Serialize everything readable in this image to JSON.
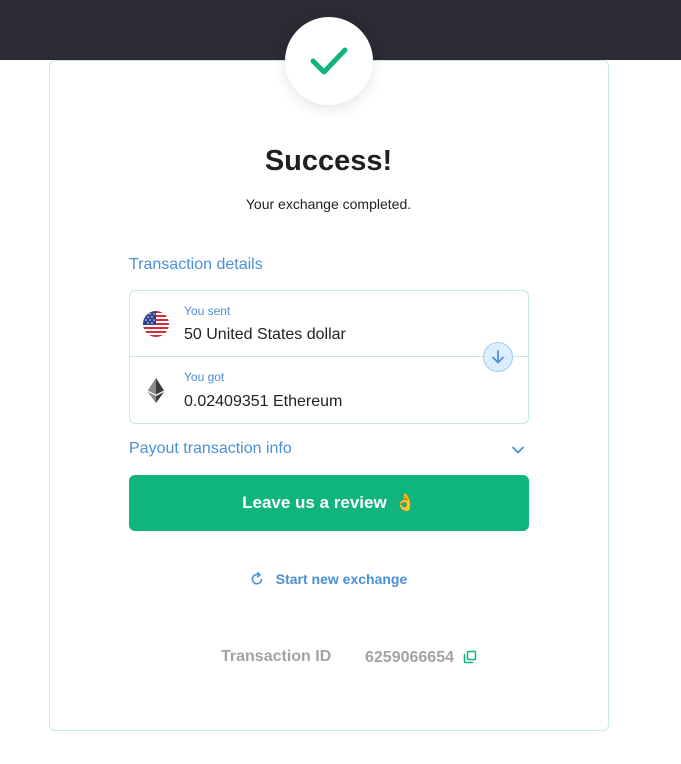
{
  "header": {
    "title": "Success!",
    "subtitle": "Your exchange completed."
  },
  "transaction": {
    "section_label": "Transaction details",
    "sent": {
      "label": "You sent",
      "value": "50 United States dollar",
      "icon": "us-flag-icon"
    },
    "got": {
      "label": "You got",
      "value": "0.02409351 Ethereum",
      "icon": "ethereum-icon"
    }
  },
  "payout": {
    "label": "Payout transaction info"
  },
  "review_button": {
    "label": "Leave us a review",
    "emoji": "👌"
  },
  "new_exchange": {
    "label": "Start new exchange"
  },
  "transaction_id": {
    "label": "Transaction ID",
    "value": "6259066654"
  },
  "colors": {
    "accent_green": "#0fb57c",
    "link_blue": "#4a90d9",
    "border": "#bfeee0",
    "top_bar": "#2a2b35"
  }
}
